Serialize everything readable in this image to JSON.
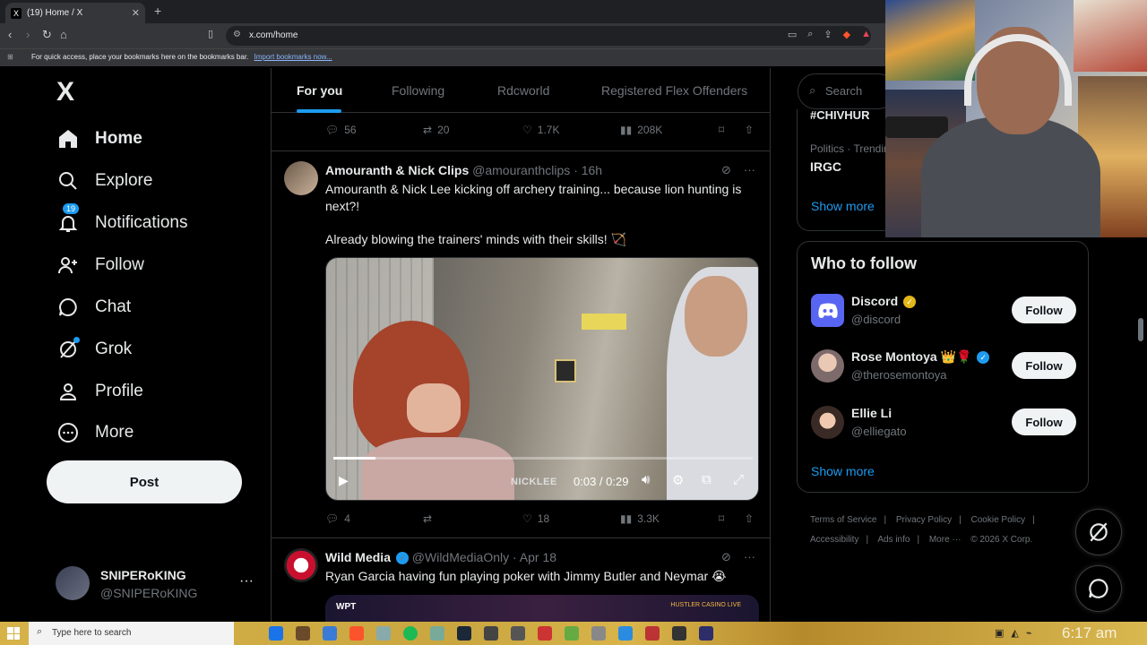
{
  "browser": {
    "tab_title": "(19) Home / X",
    "tab_favicon": "X",
    "url": "x.com/home",
    "bookmarks_text": "For quick access, place your bookmarks here on the bookmarks bar.",
    "bookmarks_link": "Import bookmarks now..."
  },
  "nav": {
    "logo": "X",
    "items": [
      {
        "label": "Home",
        "icon": "home-icon"
      },
      {
        "label": "Explore",
        "icon": "search-icon"
      },
      {
        "label": "Notifications",
        "icon": "bell-icon",
        "badge": "19"
      },
      {
        "label": "Follow",
        "icon": "person-add-icon"
      },
      {
        "label": "Chat",
        "icon": "chat-icon"
      },
      {
        "label": "Grok",
        "icon": "grok-icon"
      },
      {
        "label": "Profile",
        "icon": "person-icon"
      },
      {
        "label": "More",
        "icon": "more-circle-icon"
      }
    ],
    "post_button": "Post",
    "account": {
      "name": "SNIPERoKING",
      "handle": "@SNIPERoKING"
    }
  },
  "feed": {
    "tabs": [
      "For you",
      "Following",
      "Rdcworld",
      "Registered Flex Offenders"
    ],
    "prev_tweet_stats": {
      "replies": "56",
      "reposts": "20",
      "likes": "1.7K",
      "views": "208K"
    },
    "tweet1": {
      "name": "Amouranth & Nick Clips",
      "handle": "@amouranthclips",
      "time": "· 16h",
      "text1": "Amouranth & Nick Lee kicking off archery training... because lion hunting is next?!",
      "text2": "Already blowing the trainers' minds with their skills! 🏹",
      "video_time": "0:03 / 0:29",
      "video_progress": 0.1,
      "watermark": "NICKLEE",
      "stats": {
        "replies": "4",
        "reposts": "",
        "likes": "18",
        "views": "3.3K"
      }
    },
    "tweet2": {
      "name": "Wild Media",
      "handle": "@WildMediaOnly",
      "time": "· Apr 18",
      "text": "Ryan Garcia having fun playing poker with Jimmy Butler and Neymar 😭",
      "media_label": "WPT",
      "media_label2": "HUSTLER CASINO LIVE"
    }
  },
  "right": {
    "search_placeholder": "Search",
    "trend1": "#CHIVHUR",
    "trend2_category": "Politics · Trendin",
    "trend2": "IRGC",
    "show_more": "Show more",
    "who_to_follow": "Who to follow",
    "follow_users": [
      {
        "name": "Discord",
        "handle": "@discord",
        "button": "Follow",
        "verified_color": "#e2b719"
      },
      {
        "name": "Rose Montoya 👑🌹",
        "handle": "@therosemontoya",
        "button": "Follow",
        "verified_color": "#1d9bf0"
      },
      {
        "name": "Ellie Li",
        "handle": "@elliegato",
        "button": "Follow"
      }
    ],
    "show_more2": "Show more",
    "footer": [
      "Terms of Service",
      "Privacy Policy",
      "Cookie Policy",
      "Accessibility",
      "Ads info",
      "More ···",
      "© 2026 X Corp."
    ]
  },
  "taskbar": {
    "search_placeholder": "Type here to search",
    "time": "6:17 am"
  },
  "colors": {
    "accent": "#1d9bf0",
    "background": "#000000",
    "muted": "#71767b"
  }
}
